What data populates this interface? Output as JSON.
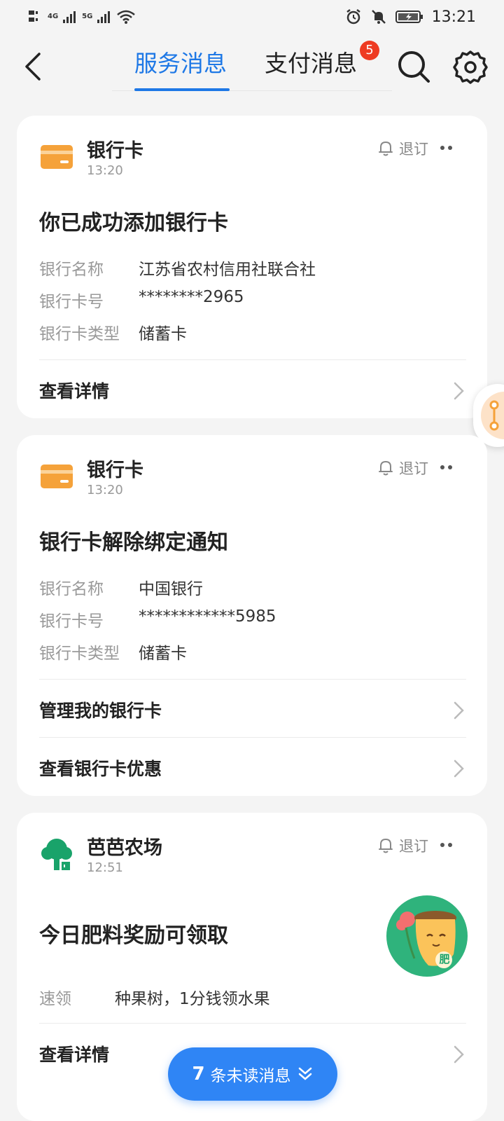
{
  "status_bar": {
    "time": "13:21",
    "net1": "4G",
    "net2": "5G"
  },
  "nav": {
    "tabs": [
      {
        "label": "服务消息",
        "active": true
      },
      {
        "label": "支付消息",
        "active": false
      }
    ],
    "badge_count": "5"
  },
  "cards": [
    {
      "source": "银行卡",
      "time": "13:20",
      "unsubscribe_label": "退订",
      "title": "你已成功添加银行卡",
      "fields": [
        {
          "label": "银行名称",
          "value": "江苏省农村信用社联合社"
        },
        {
          "label": "银行卡号",
          "value": "********2965"
        },
        {
          "label": "银行卡类型",
          "value": "储蓄卡"
        }
      ],
      "links": [
        "查看详情"
      ]
    },
    {
      "source": "银行卡",
      "time": "13:20",
      "unsubscribe_label": "退订",
      "title": "银行卡解除绑定通知",
      "fields": [
        {
          "label": "银行名称",
          "value": "中国银行"
        },
        {
          "label": "银行卡号",
          "value": "************5985"
        },
        {
          "label": "银行卡类型",
          "value": "储蓄卡"
        }
      ],
      "links": [
        "管理我的银行卡",
        "查看银行卡优惠"
      ]
    },
    {
      "source": "芭芭农场",
      "time": "12:51",
      "unsubscribe_label": "退订",
      "title": "今日肥料奖励可领取",
      "fields": [
        {
          "label": "速领",
          "value": "种果树，1分钱领水果"
        }
      ],
      "links": [
        "查看详情"
      ],
      "mascot_label": "肥"
    }
  ],
  "unread_pill": {
    "count": "7",
    "text": "条未读消息"
  },
  "colors": {
    "accent": "#1e78e6",
    "badge": "#ee3b22",
    "bank_icon": "#f5a23a",
    "farm_icon": "#19a36a"
  }
}
